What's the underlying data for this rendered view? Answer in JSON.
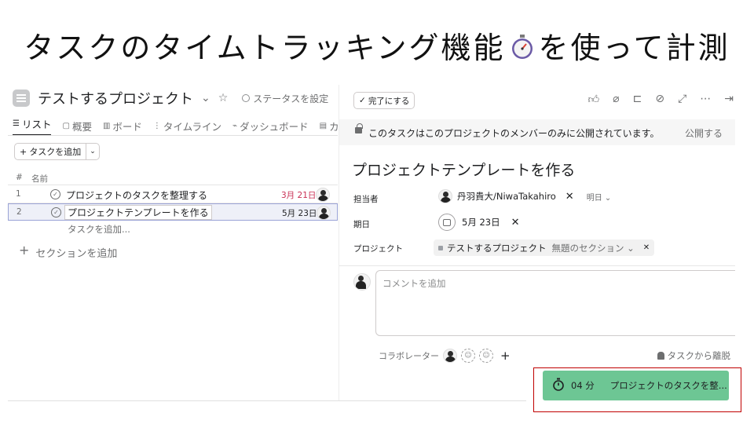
{
  "slide": {
    "title_before": "タスクのタイムトラッキング機能",
    "title_after": "を使って計測"
  },
  "project": {
    "name": "テストするプロジェクト",
    "status_label": "ステータスを設定",
    "tabs": [
      {
        "label": "リスト",
        "active": true
      },
      {
        "label": "概要"
      },
      {
        "label": "ボード"
      },
      {
        "label": "タイムライン"
      },
      {
        "label": "ダッシュボード"
      },
      {
        "label": "カレ"
      }
    ],
    "add_task_label": "タスクを追加",
    "columns": {
      "num": "#",
      "name": "名前"
    },
    "tasks": [
      {
        "num": "1",
        "name": "プロジェクトのタスクを整理する",
        "due": "3月 21日",
        "due_color": "#c92f54"
      },
      {
        "num": "2",
        "name": "プロジェクトテンプレートを作る",
        "due": "5月 23日",
        "due_color": "#1e1f21"
      }
    ],
    "add_task_inline": "タスクを追加...",
    "add_section": "セクションを追加"
  },
  "detail": {
    "complete_label": "完了にする",
    "notice": "このタスクはこのプロジェクトのメンバーのみに公開されています。",
    "publish_label": "公開する",
    "task_title": "プロジェクトテンプレートを作る",
    "assignee_label": "担当者",
    "assignee_name": "丹羽貴大/NiwaTakahiro",
    "assignee_due_hint": "明日",
    "due_label": "期日",
    "due_value": "5月 23日",
    "project_label": "プロジェクト",
    "project_name": "テストするプロジェクト",
    "section_name": "無題のセクション",
    "comment_placeholder": "コメントを追加",
    "collaborators_label": "コラボレーター",
    "leave_label": "タスクから離脱"
  },
  "timer": {
    "minutes": "04 分",
    "task": "プロジェクトのタスクを整..."
  },
  "colors": {
    "timer_green": "#6dc694",
    "highlight_frame": "#c00000",
    "overdue_red": "#c92f54"
  }
}
